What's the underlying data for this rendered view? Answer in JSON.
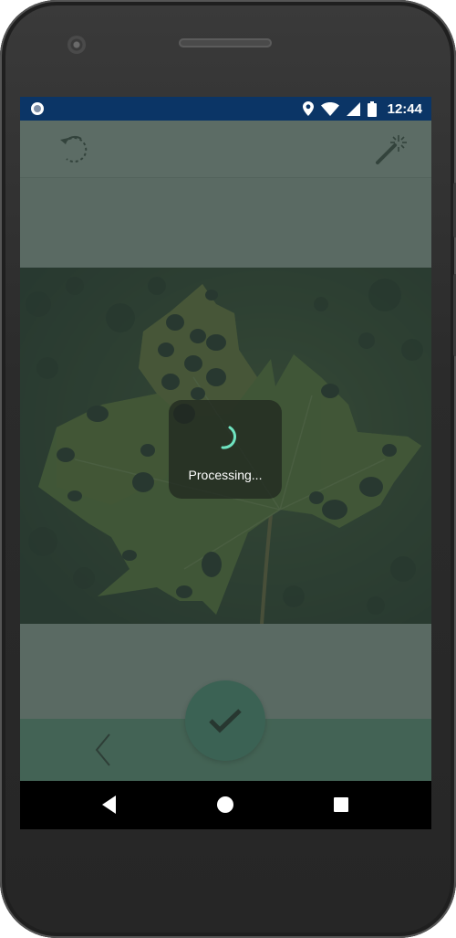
{
  "statusbar": {
    "time": "12:44",
    "icons": [
      "app-notification-icon",
      "location-icon",
      "wifi-icon",
      "signal-icon",
      "battery-icon"
    ]
  },
  "toolbar": {
    "undo_icon": "undo-icon",
    "magic_icon": "magic-wand-icon"
  },
  "image": {
    "subject": "leaf-photo"
  },
  "dialog": {
    "text": "Processing..."
  },
  "bottom_bar": {
    "back_icon": "chevron-left-icon",
    "confirm_icon": "checkmark-icon"
  },
  "navbar": {
    "buttons": [
      "back-triangle-icon",
      "home-circle-icon",
      "recents-square-icon"
    ]
  },
  "colors": {
    "statusbar": "#0b3566",
    "accent": "#6bd1b0",
    "spinner": "#6fe3c0",
    "overlay": "#2e423a"
  }
}
